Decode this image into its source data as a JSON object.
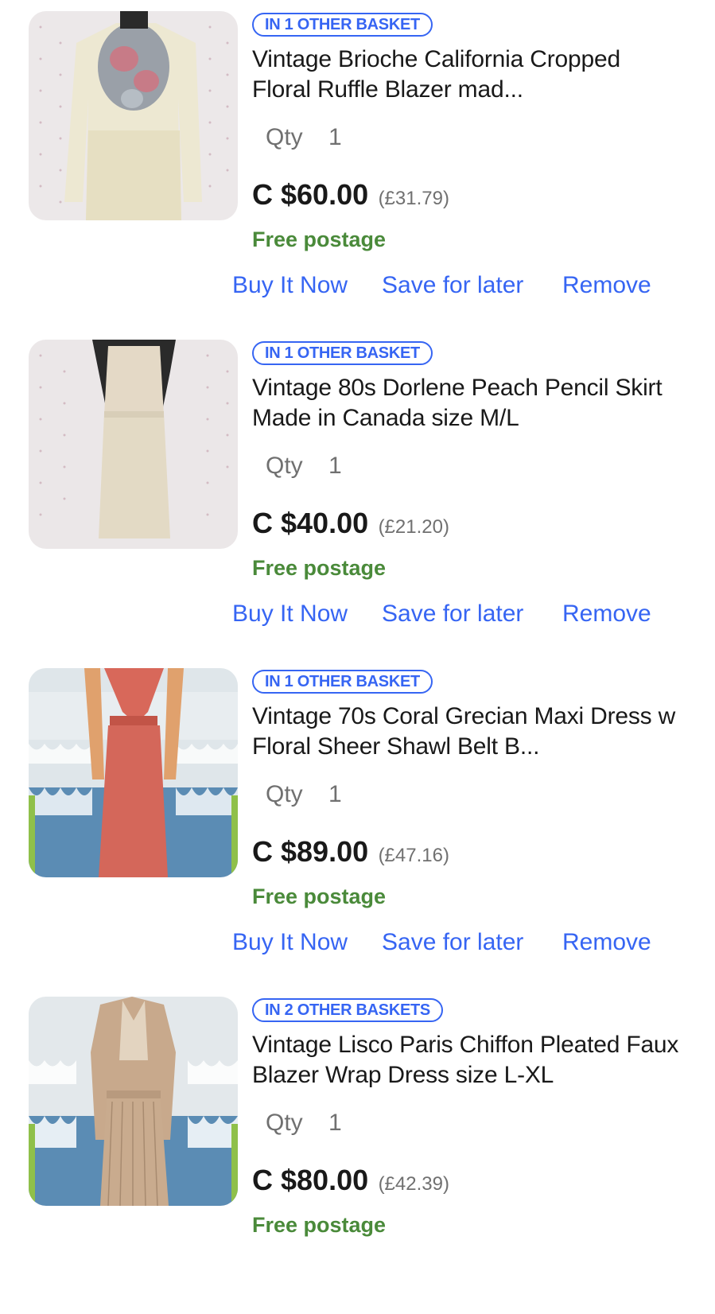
{
  "cart": {
    "items": [
      {
        "badge": "IN 1 OTHER BASKET",
        "title": "Vintage Brioche California Cropped Floral Ruffle Blazer mad...",
        "qty_label": "Qty",
        "qty": "1",
        "price": "C $60.00",
        "alt_price": "(£31.79)",
        "shipping": "Free postage",
        "buy_label": "Buy It Now",
        "save_label": "Save for later",
        "remove_label": "Remove"
      },
      {
        "badge": "IN 1 OTHER BASKET",
        "title": "Vintage 80s Dorlene Peach Pencil Skirt Made in Canada size M/L",
        "qty_label": "Qty",
        "qty": "1",
        "price": "C $40.00",
        "alt_price": "(£21.20)",
        "shipping": "Free postage",
        "buy_label": "Buy It Now",
        "save_label": "Save for later",
        "remove_label": "Remove"
      },
      {
        "badge": "IN 1 OTHER BASKET",
        "title": "Vintage 70s Coral Grecian Maxi Dress w Floral Sheer Shawl Belt B...",
        "qty_label": "Qty",
        "qty": "1",
        "price": "C $89.00",
        "alt_price": "(£47.16)",
        "shipping": "Free postage",
        "buy_label": "Buy It Now",
        "save_label": "Save for later",
        "remove_label": "Remove"
      },
      {
        "badge": "IN 2 OTHER BASKETS",
        "title": "Vintage Lisco Paris Chiffon Pleated Faux Blazer Wrap Dress size L-XL",
        "qty_label": "Qty",
        "qty": "1",
        "price": "C $80.00",
        "alt_price": "(£42.39)",
        "shipping": "Free postage"
      }
    ]
  },
  "colors": {
    "link": "#3665f3",
    "shipping": "#4a8a3a",
    "text": "#191919",
    "muted": "#707070"
  }
}
